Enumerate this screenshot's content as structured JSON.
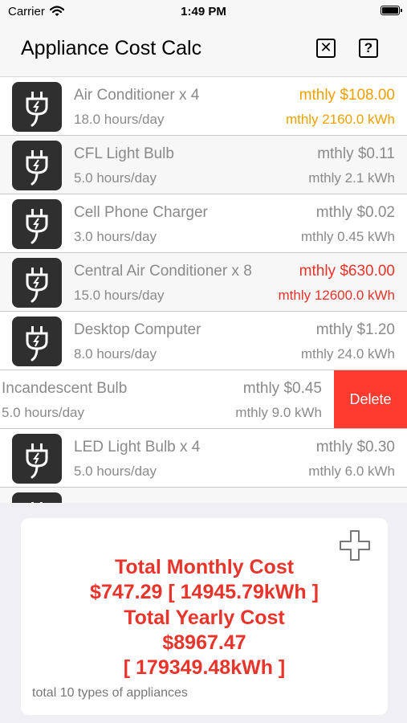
{
  "status": {
    "carrier": "Carrier",
    "time": "1:49 PM"
  },
  "nav": {
    "title": "Appliance Cost Calc",
    "close_icon": "close-box-icon",
    "help_label": "?"
  },
  "appliances": [
    {
      "name": "Air Conditioner x 4",
      "hours": "18.0 hours/day",
      "cost": "mthly $108.00",
      "kwh": "mthly 2160.0 kWh",
      "highlight": "#f0a000"
    },
    {
      "name": "CFL Light Bulb",
      "hours": "5.0 hours/day",
      "cost": "mthly $0.11",
      "kwh": "mthly 2.1 kWh"
    },
    {
      "name": "Cell Phone Charger",
      "hours": "3.0 hours/day",
      "cost": "mthly $0.02",
      "kwh": "mthly 0.45 kWh"
    },
    {
      "name": "Central Air Conditioner x 8",
      "hours": "15.0 hours/day",
      "cost": "mthly $630.00",
      "kwh": "mthly 12600.0 kWh",
      "highlight": "#e8342b"
    },
    {
      "name": "Desktop Computer",
      "hours": "8.0 hours/day",
      "cost": "mthly $1.20",
      "kwh": "mthly 24.0 kWh"
    },
    {
      "name": "Incandescent Bulb",
      "hours": "5.0 hours/day",
      "cost": "mthly $0.45",
      "kwh": "mthly 9.0 kWh",
      "delete_label": "Delete"
    },
    {
      "name": "LED Light Bulb x 4",
      "hours": "5.0 hours/day",
      "cost": "mthly $0.30",
      "kwh": "mthly 6.0 kWh"
    }
  ],
  "summary": {
    "monthly_label": "Total Monthly Cost",
    "monthly_value": "$747.29 [ 14945.79kWh ]",
    "yearly_label": "Total Yearly Cost",
    "yearly_cost": "$8967.47",
    "yearly_kwh": "[ 179349.48kWh ]",
    "note": "total 10 types of appliances"
  }
}
